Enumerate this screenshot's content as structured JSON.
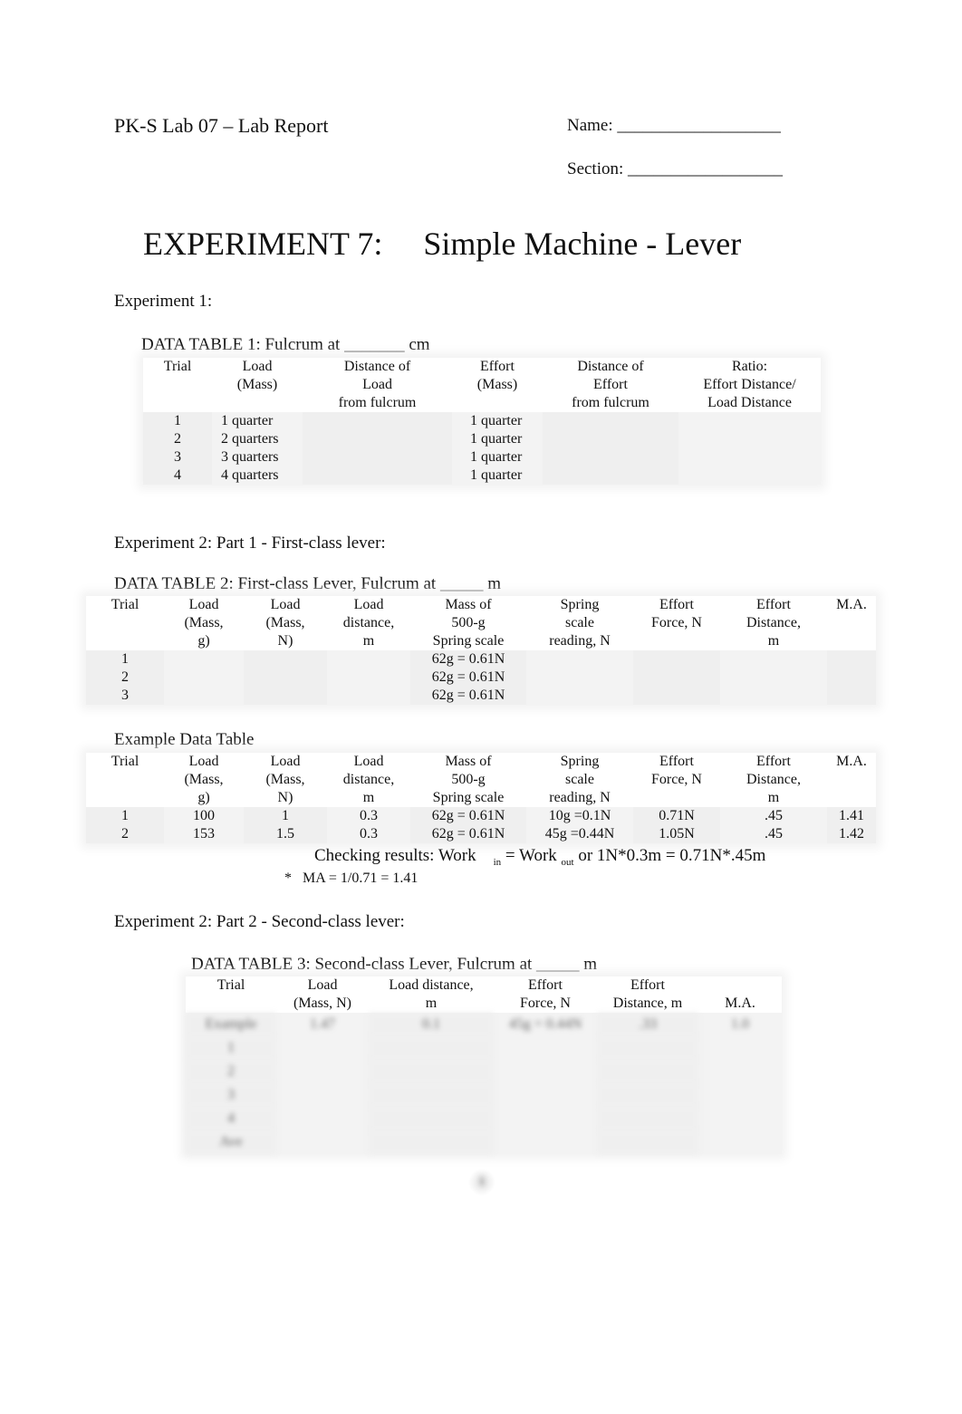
{
  "header": {
    "report_title": "PK-S Lab 07 – Lab Report",
    "name_label": "Name: ___________________",
    "section_label": "Section: __________________"
  },
  "title": "EXPERIMENT 7:     Simple Machine - Lever",
  "experiment1": {
    "heading": "Experiment 1:",
    "table_caption": "DATA TABLE 1: Fulcrum at _______ cm",
    "columns": [
      "Trial",
      "Load\n(Mass)",
      "Distance of\nLoad\nfrom fulcrum",
      "Effort\n(Mass)",
      "Distance of\nEffort\nfrom fulcrum",
      "Ratio:\nEffort Distance/\nLoad Distance"
    ],
    "rows": [
      [
        "1",
        "1 quarter",
        "",
        "1 quarter",
        "",
        ""
      ],
      [
        "2",
        "2 quarters",
        "",
        "1 quarter",
        "",
        ""
      ],
      [
        "3",
        "3 quarters",
        "",
        "1 quarter",
        "",
        ""
      ],
      [
        "4",
        "4 quarters",
        "",
        "1 quarter",
        "",
        ""
      ]
    ]
  },
  "experiment2_part1": {
    "heading": "Experiment 2: Part 1 - First-class lever:",
    "table_caption": "DATA TABLE 2: First-class Lever, Fulcrum at _____ m",
    "columns": [
      "Trial",
      "Load\n(Mass,\ng)",
      "Load\n(Mass,\nN)",
      "Load\ndistance,\nm",
      "Mass of\n500-g\nSpring scale",
      "Spring\nscale\nreading, N",
      "Effort\nForce, N",
      "Effort\nDistance,\nm",
      "M.A."
    ],
    "rows": [
      [
        "1",
        "",
        "",
        "",
        "62g = 0.61N",
        "",
        "",
        "",
        ""
      ],
      [
        "2",
        "",
        "",
        "",
        "62g = 0.61N",
        "",
        "",
        "",
        ""
      ],
      [
        "3",
        "",
        "",
        "",
        "62g = 0.61N",
        "",
        "",
        "",
        ""
      ]
    ]
  },
  "example_table": {
    "caption": "Example Data Table",
    "columns": [
      "Trial",
      "Load\n(Mass,\ng)",
      "Load\n(Mass,\nN)",
      "Load\ndistance,\nm",
      "Mass of\n500-g\nSpring scale",
      "Spring\nscale\nreading, N",
      "Effort\nForce, N",
      "Effort\nDistance,\nm",
      "M.A."
    ],
    "rows": [
      [
        "1",
        "100",
        "1",
        "0.3",
        "62g = 0.61N",
        "10g =0.1N",
        "0.71N",
        ".45",
        "1.41"
      ],
      [
        "2",
        "153",
        "1.5",
        "0.3",
        "62g = 0.61N",
        "45g =0.44N",
        "1.05N",
        ".45",
        "1.42"
      ]
    ],
    "check_prefix": "Checking results: Work",
    "check_sub_in": "in",
    "check_mid": " = Work",
    "check_sub_out": "out",
    "check_suffix": " or 1N*0.3m = 0.71N*.45m",
    "note": "*   MA = 1/0.71 = 1.41"
  },
  "experiment2_part2": {
    "heading": "Experiment 2: Part 2 - Second-class lever:",
    "table_caption": "DATA TABLE 3: Second-class Lever, Fulcrum at _____ m",
    "columns": [
      "Trial",
      "Load\n(Mass, N)",
      "Load distance,\nm",
      "Effort\nForce, N",
      "Effort\nDistance, m",
      "\nM.A."
    ],
    "rows": [
      [
        "Example",
        "1.47",
        "0.1",
        "45g = 0.44N",
        ".33",
        "1.0"
      ],
      [
        "1",
        "",
        "",
        "",
        "",
        ""
      ],
      [
        "2",
        "",
        "",
        "",
        "",
        ""
      ],
      [
        "3",
        "",
        "",
        "",
        "",
        ""
      ],
      [
        "4",
        "",
        "",
        "",
        "",
        ""
      ],
      [
        "Ave",
        "",
        "",
        "",
        "",
        ""
      ]
    ]
  },
  "page_number": "1"
}
